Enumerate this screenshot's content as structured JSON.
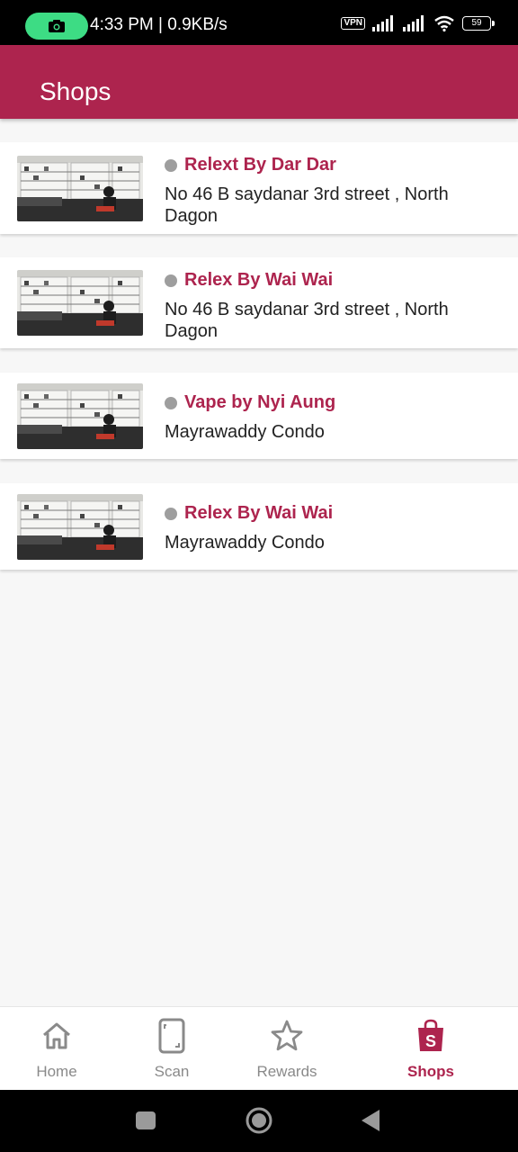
{
  "status_bar": {
    "time_speed": "4:33 PM | 0.9KB/s",
    "vpn": "VPN",
    "battery": "59"
  },
  "app_bar": {
    "title": "Shops"
  },
  "shops": [
    {
      "name": "Relext By Dar Dar",
      "address": "No 46 B saydanar 3rd street , North Dagon"
    },
    {
      "name": "Relex By Wai Wai",
      "address": "No 46 B saydanar 3rd street , North Dagon"
    },
    {
      "name": "Vape by Nyi Aung",
      "address": "Mayrawaddy Condo"
    },
    {
      "name": "Relex By Wai Wai",
      "address": "Mayrawaddy Condo"
    }
  ],
  "bottom_nav": {
    "items": [
      {
        "label": "Home",
        "icon": "home-icon",
        "active": false
      },
      {
        "label": "Scan",
        "icon": "scan-phone-icon",
        "active": false
      },
      {
        "label": "Rewards",
        "icon": "star-icon",
        "active": false
      },
      {
        "label": "Shops",
        "icon": "shopping-bag-icon",
        "active": true
      }
    ]
  },
  "colors": {
    "accent": "#ad244e",
    "status_dot": "#9e9e9e",
    "nav_inactive": "#8a8a8a",
    "camera_pill": "#3ddc84"
  }
}
